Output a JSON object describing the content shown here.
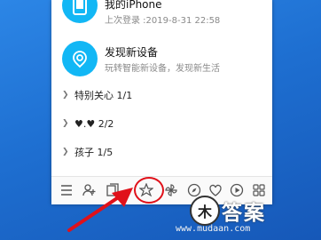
{
  "devices": [
    {
      "title": "我的iPhone",
      "subtitle": "上次登录 :2019-8-31 22:58",
      "icon": "phone-icon"
    },
    {
      "title": "发现新设备",
      "subtitle": "玩转智能新设备，发现新生活",
      "icon": "discover-device-icon"
    }
  ],
  "groups": [
    {
      "label": "特别关心 1/1"
    },
    {
      "label": "♥.♥ 2/2"
    },
    {
      "label": "孩子 1/5"
    }
  ],
  "toolbar": {
    "icons": [
      "menu-icon",
      "add-friend-icon",
      "file-icon",
      "qzone-star-icon",
      "pinwheel-icon",
      "compass-icon",
      "heart-shield-icon",
      "play-icon",
      "apps-grid-icon"
    ]
  },
  "watermark": {
    "logo_char": "木",
    "brand": "答案",
    "url": "www.mudaan.com"
  },
  "colors": {
    "accent": "#12b7f5",
    "highlight": "#e0111a",
    "desktop": "#1e6fd1"
  }
}
